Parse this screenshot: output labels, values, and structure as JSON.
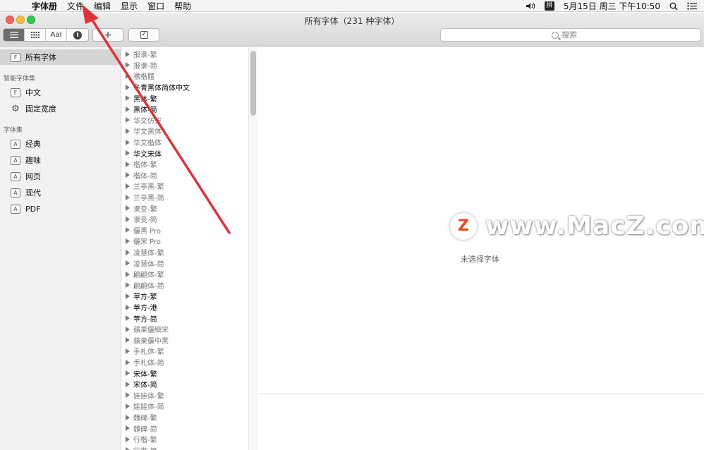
{
  "menubar": {
    "items": [
      "字体册",
      "文件",
      "编辑",
      "显示",
      "窗口",
      "帮助"
    ],
    "date_time": "5月15日 周三 下午10:50",
    "ime_label": "拼"
  },
  "window": {
    "title": "所有字体（231 种字体）"
  },
  "toolbar": {
    "view_buttons": [
      "list-icon",
      "grid-icon",
      "Aa",
      "info-icon"
    ],
    "text_sample_label": "AaI",
    "info_label": "i",
    "add_label": "+",
    "check_label": "✓",
    "search_placeholder": "搜索"
  },
  "sidebar": {
    "all_fonts": "所有字体",
    "smart_header": "智能字体集",
    "smart_items": [
      {
        "label": "中文",
        "icon": "font-collection-icon",
        "glyph": "F"
      },
      {
        "label": "固定宽度",
        "icon": "gear-icon",
        "glyph": "⚙"
      }
    ],
    "collections_header": "字体集",
    "collections": [
      {
        "label": "经典",
        "glyph": "A"
      },
      {
        "label": "趣味",
        "glyph": "A"
      },
      {
        "label": "网页",
        "glyph": "A"
      },
      {
        "label": "现代",
        "glyph": "A"
      },
      {
        "label": "PDF",
        "glyph": "A"
      }
    ],
    "all_fonts_glyph": "F"
  },
  "fonts": [
    {
      "name": "报隶-繁",
      "strong": false
    },
    {
      "name": "报隶-简",
      "strong": false
    },
    {
      "name": "標楷體",
      "strong": false
    },
    {
      "name": "冬青黑体简体中文",
      "strong": true
    },
    {
      "name": "黑体-繁",
      "strong": true
    },
    {
      "name": "黑体-简",
      "strong": true
    },
    {
      "name": "华文仿宋",
      "strong": false
    },
    {
      "name": "华文黑体",
      "strong": false
    },
    {
      "name": "华文楷体",
      "strong": false
    },
    {
      "name": "华文宋体",
      "strong": true
    },
    {
      "name": "楷体-繁",
      "strong": false
    },
    {
      "name": "楷体-简",
      "strong": false
    },
    {
      "name": "兰亭黑-繁",
      "strong": false
    },
    {
      "name": "兰亭黑-简",
      "strong": false
    },
    {
      "name": "隶变-繁",
      "strong": false
    },
    {
      "name": "隶变-简",
      "strong": false
    },
    {
      "name": "儷黑 Pro",
      "strong": false
    },
    {
      "name": "儷宋 Pro",
      "strong": false
    },
    {
      "name": "凌慧体-繁",
      "strong": false
    },
    {
      "name": "凌慧体-简",
      "strong": false
    },
    {
      "name": "翩翩体-繁",
      "strong": false
    },
    {
      "name": "翩翩体-简",
      "strong": false
    },
    {
      "name": "苹方-繁",
      "strong": true
    },
    {
      "name": "苹方-港",
      "strong": true
    },
    {
      "name": "苹方-简",
      "strong": true
    },
    {
      "name": "蘋果儷細宋",
      "strong": false
    },
    {
      "name": "蘋果儷中黑",
      "strong": false
    },
    {
      "name": "手札体-繁",
      "strong": false
    },
    {
      "name": "手札体-简",
      "strong": false
    },
    {
      "name": "宋体-繁",
      "strong": true
    },
    {
      "name": "宋体-简",
      "strong": true
    },
    {
      "name": "娃娃体-繁",
      "strong": false
    },
    {
      "name": "娃娃体-简",
      "strong": false
    },
    {
      "name": "魏碑-繁",
      "strong": false
    },
    {
      "name": "魏碑-简",
      "strong": false
    },
    {
      "name": "行楷-繁",
      "strong": false
    },
    {
      "name": "行楷-简",
      "strong": false
    }
  ],
  "preview": {
    "empty_text": "未选择字体"
  },
  "watermark": {
    "logo": "Z",
    "text": "www.MacZ.com"
  },
  "colors": {
    "arrow": "#e0323a",
    "selection": "#d5d5d5",
    "watermark_logo": "#e8491d"
  }
}
